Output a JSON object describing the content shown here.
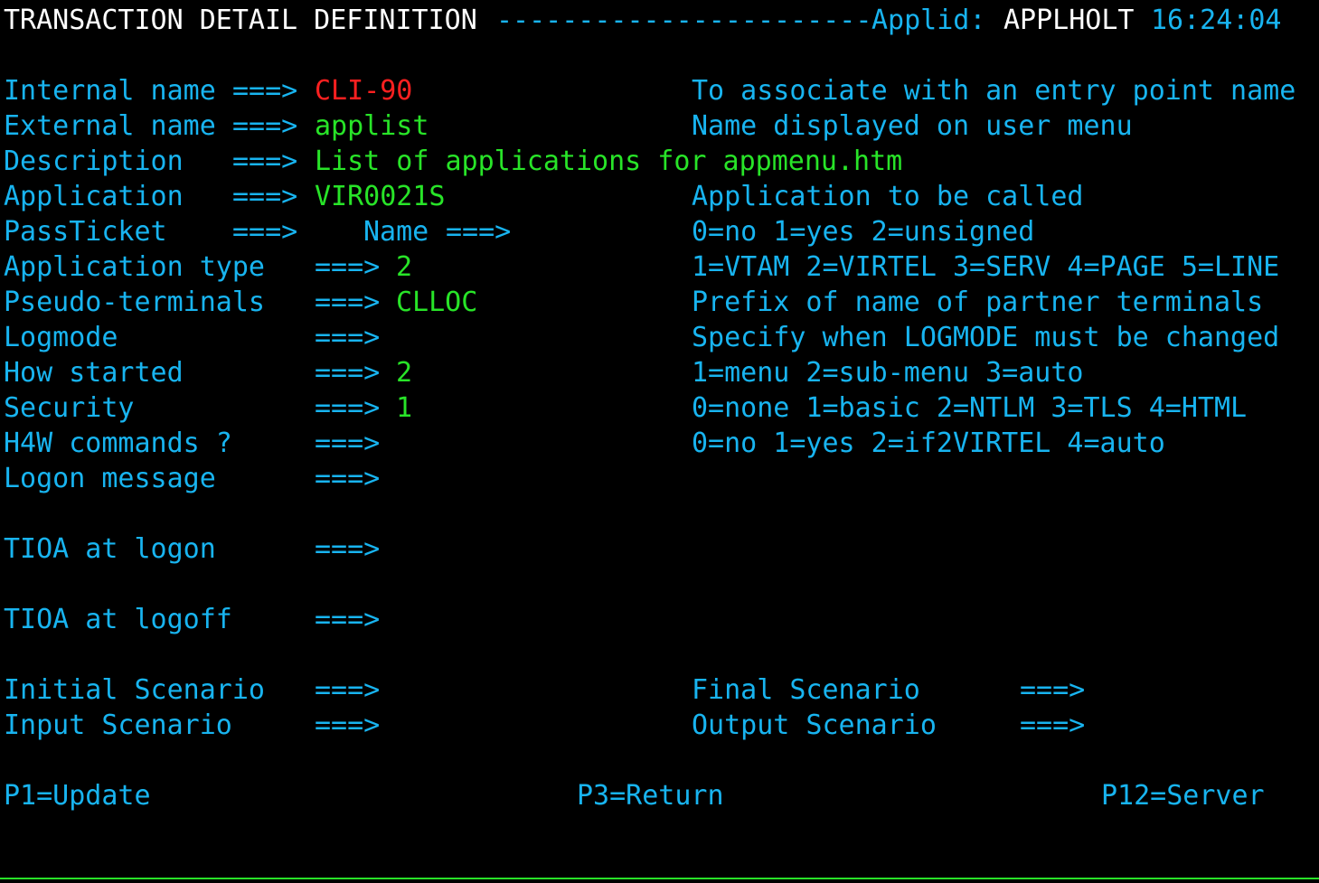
{
  "header": {
    "title": "TRANSACTION DETAIL DEFINITION",
    "dashes": "-----------------------",
    "applid_label": "Applid:",
    "applid_value": "APPLHOLT",
    "time": "16:24:04"
  },
  "arrow": "===>",
  "fields": {
    "internal_name": {
      "label": "Internal name",
      "value": "CLI-90",
      "help": "To associate with an entry point name"
    },
    "external_name": {
      "label": "External name",
      "value": "applist",
      "help": "Name displayed on user menu"
    },
    "description": {
      "label": "Description",
      "value": "List of applications for appmenu.htm"
    },
    "application": {
      "label": "Application",
      "value": "VIR0021S",
      "help": "Application to be called"
    },
    "passticket": {
      "label": "PassTicket",
      "value": "",
      "name_label": "Name",
      "name_value": "",
      "help": "0=no 1=yes 2=unsigned"
    },
    "application_type": {
      "label": "Application type",
      "value": "2",
      "help": "1=VTAM 2=VIRTEL 3=SERV 4=PAGE 5=LINE"
    },
    "pseudo_terminals": {
      "label": "Pseudo-terminals",
      "value": "CLLOC",
      "help": "Prefix of name of partner terminals"
    },
    "logmode": {
      "label": "Logmode",
      "value": "",
      "help": "Specify when LOGMODE must be changed"
    },
    "how_started": {
      "label": "How started",
      "value": "2",
      "help": "1=menu 2=sub-menu 3=auto"
    },
    "security": {
      "label": "Security",
      "value": "1",
      "help": "0=none 1=basic 2=NTLM 3=TLS 4=HTML"
    },
    "h4w_commands": {
      "label": "H4W commands ?",
      "value": "",
      "help": "0=no 1=yes 2=if2VIRTEL 4=auto"
    },
    "logon_message": {
      "label": "Logon message",
      "value": ""
    },
    "tioa_logon": {
      "label": "TIOA at logon",
      "value": ""
    },
    "tioa_logoff": {
      "label": "TIOA at logoff",
      "value": ""
    },
    "initial_scenario": {
      "label": "Initial Scenario",
      "value": ""
    },
    "final_scenario": {
      "label": "Final Scenario",
      "value": ""
    },
    "input_scenario": {
      "label": "Input Scenario",
      "value": ""
    },
    "output_scenario": {
      "label": "Output Scenario",
      "value": ""
    }
  },
  "pf_keys": {
    "p1": "P1=Update",
    "p3": "P3=Return",
    "p12": "P12=Server"
  },
  "colors": {
    "background": "#000000",
    "label": "#18b4f0",
    "value": "#28e428",
    "error_value": "#ff2020",
    "title": "#ffffff"
  }
}
